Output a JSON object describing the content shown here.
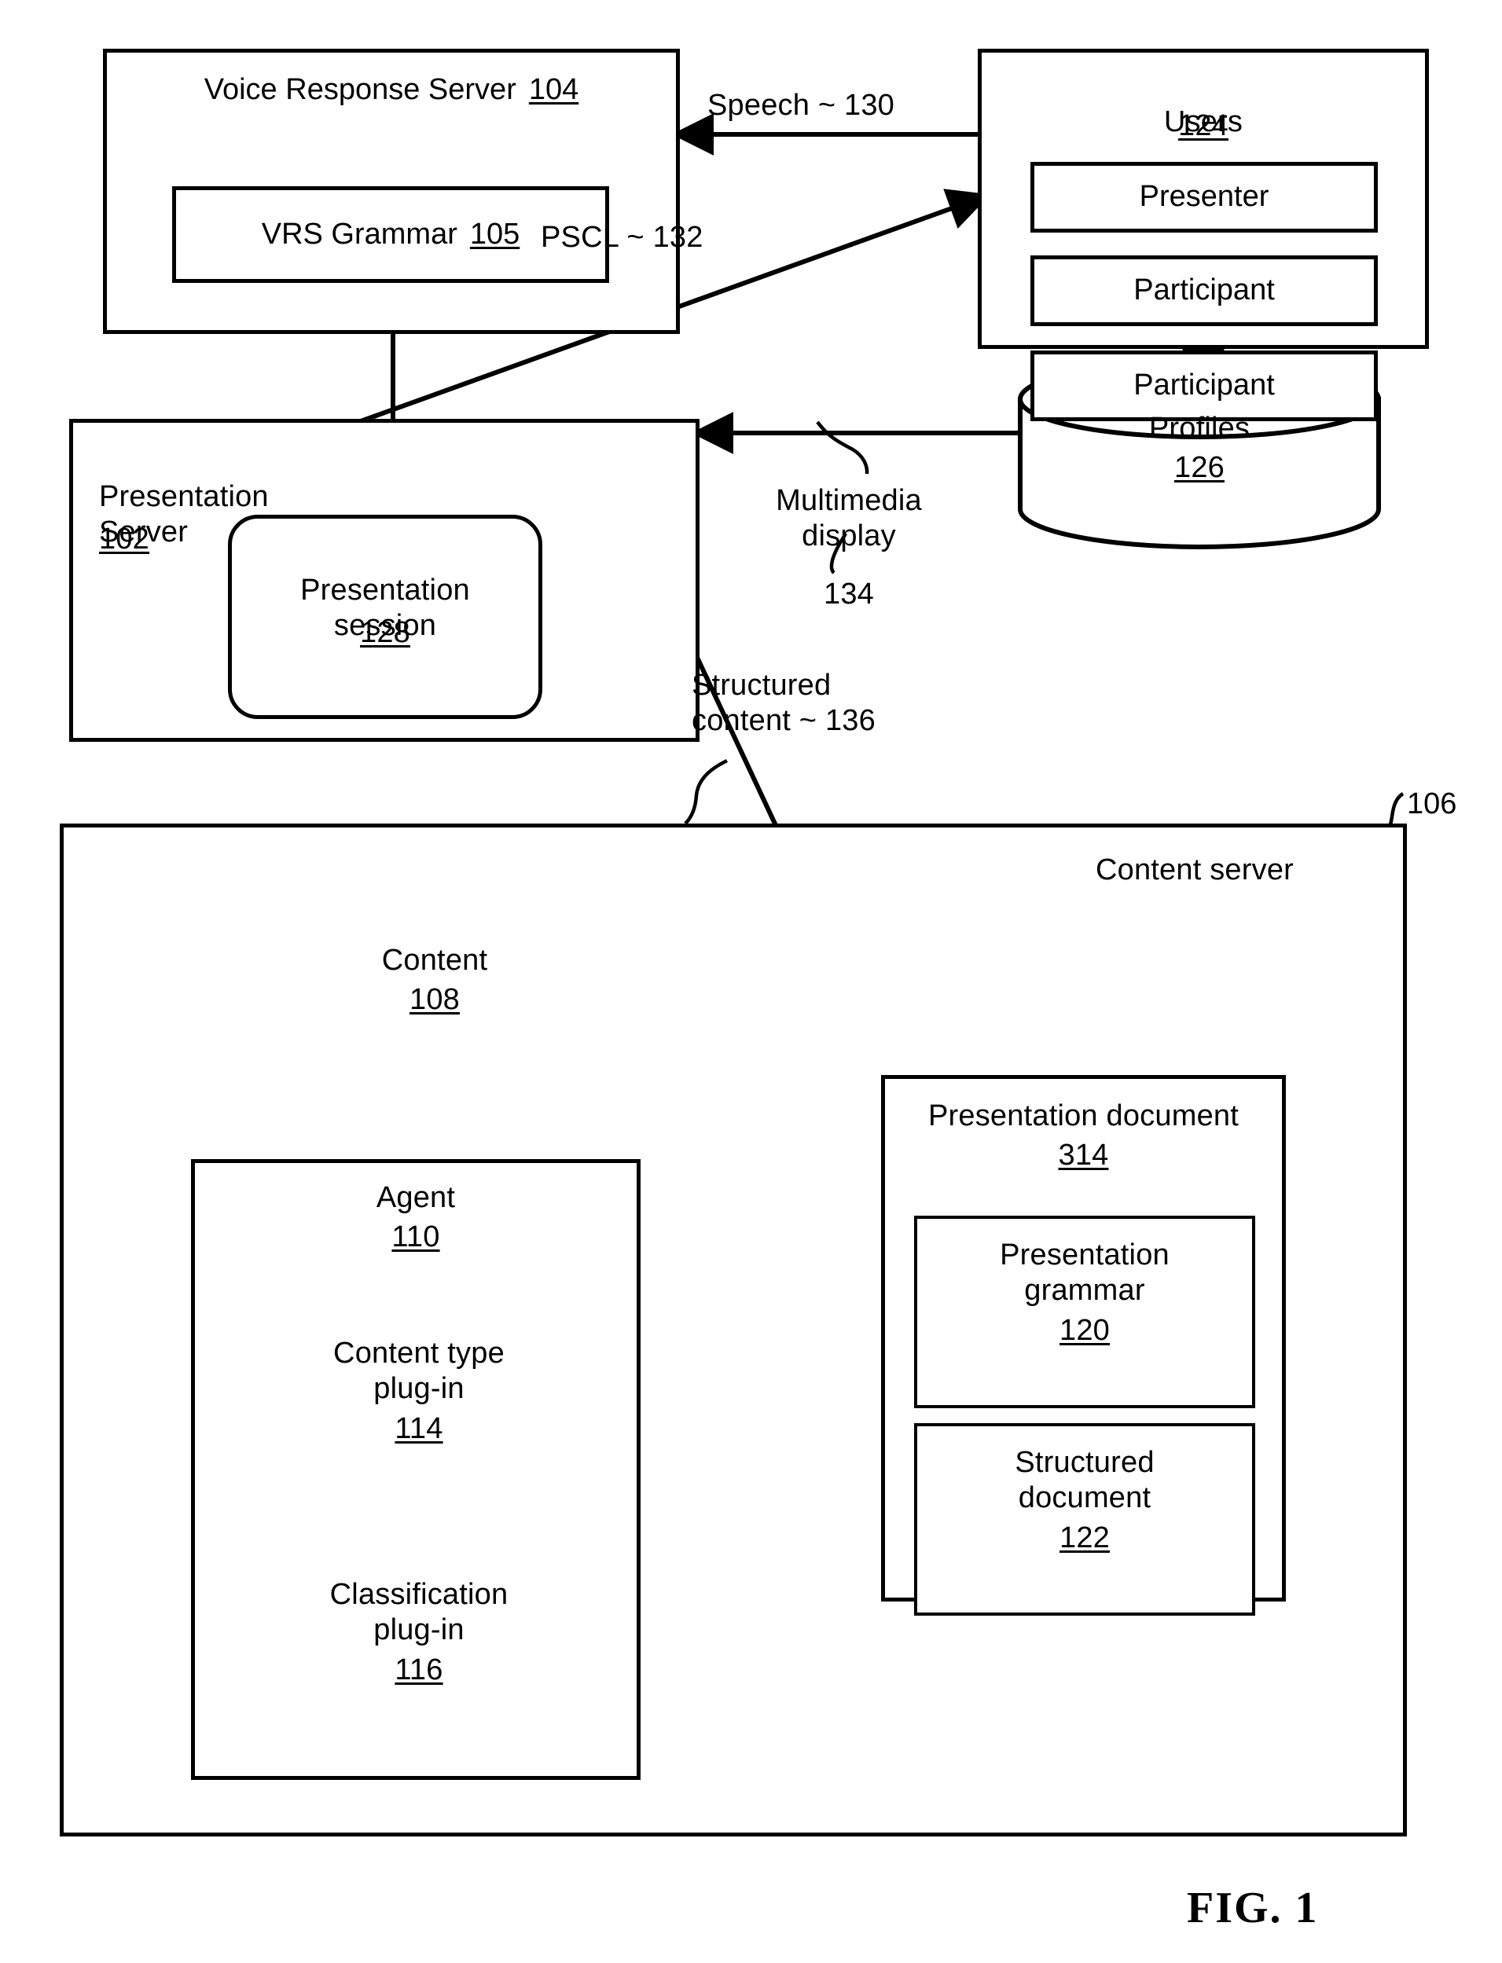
{
  "figure": {
    "caption": "FIG.  1",
    "accent_color": "#000000",
    "background_color": "#ffffff"
  },
  "blocks": {
    "voice_response_server": {
      "label": "Voice Response Server",
      "ref": "104"
    },
    "vrs_grammar": {
      "label": "VRS Grammar",
      "ref": "105"
    },
    "presentation_server": {
      "label": "Presentation\nServer",
      "ref": "102"
    },
    "presentation_session": {
      "label": "Presentation\nsession",
      "ref": "128"
    },
    "users": {
      "label": "Users",
      "ref": "124"
    },
    "user_roles": [
      {
        "label": "Presenter"
      },
      {
        "label": "Participant"
      },
      {
        "label": "Participant"
      }
    ],
    "profiles": {
      "label": "Profiles",
      "ref": "126"
    },
    "content_server": {
      "label": "Content server",
      "ref": "106"
    },
    "content_store": {
      "label": "Content",
      "ref": "108"
    },
    "agent": {
      "label": "Agent",
      "ref": "110"
    },
    "content_type_plugin": {
      "label": "Content type\nplug-in",
      "ref": "114"
    },
    "classification_plugin": {
      "label": "Classification\nplug-in",
      "ref": "116"
    },
    "presentation_document": {
      "label": "Presentation document",
      "ref": "314"
    },
    "presentation_grammar": {
      "label": "Presentation\ngrammar",
      "ref": "120"
    },
    "structured_document": {
      "label": "Structured\ndocument",
      "ref": "122"
    }
  },
  "connectors": {
    "speech": {
      "label": "Speech ~ 130",
      "from": "users",
      "to": "voice_response_server"
    },
    "pscl": {
      "label": "PSCL ~ 132",
      "from": "voice_response_server",
      "to": "presentation_server"
    },
    "multimedia_display": {
      "label": "Multimedia\ndisplay",
      "ref": "134",
      "from": "presentation_session",
      "to": "users"
    },
    "structured_content": {
      "label": "Structured\ncontent  ~ 136",
      "from": "presentation_document",
      "to": "presentation_server"
    },
    "grammar_feedback": {
      "from": "presentation_server",
      "to": "vrs_grammar"
    },
    "profiles_to_presentation_server": {
      "from": "profiles",
      "to": "presentation_server"
    },
    "users_to_profiles": {
      "from": "users",
      "to": "profiles"
    },
    "content_to_agent": {
      "from": "content_store",
      "to": "agent"
    },
    "agent_to_presentation_document": {
      "from": "agent",
      "to": "presentation_grammar"
    }
  }
}
